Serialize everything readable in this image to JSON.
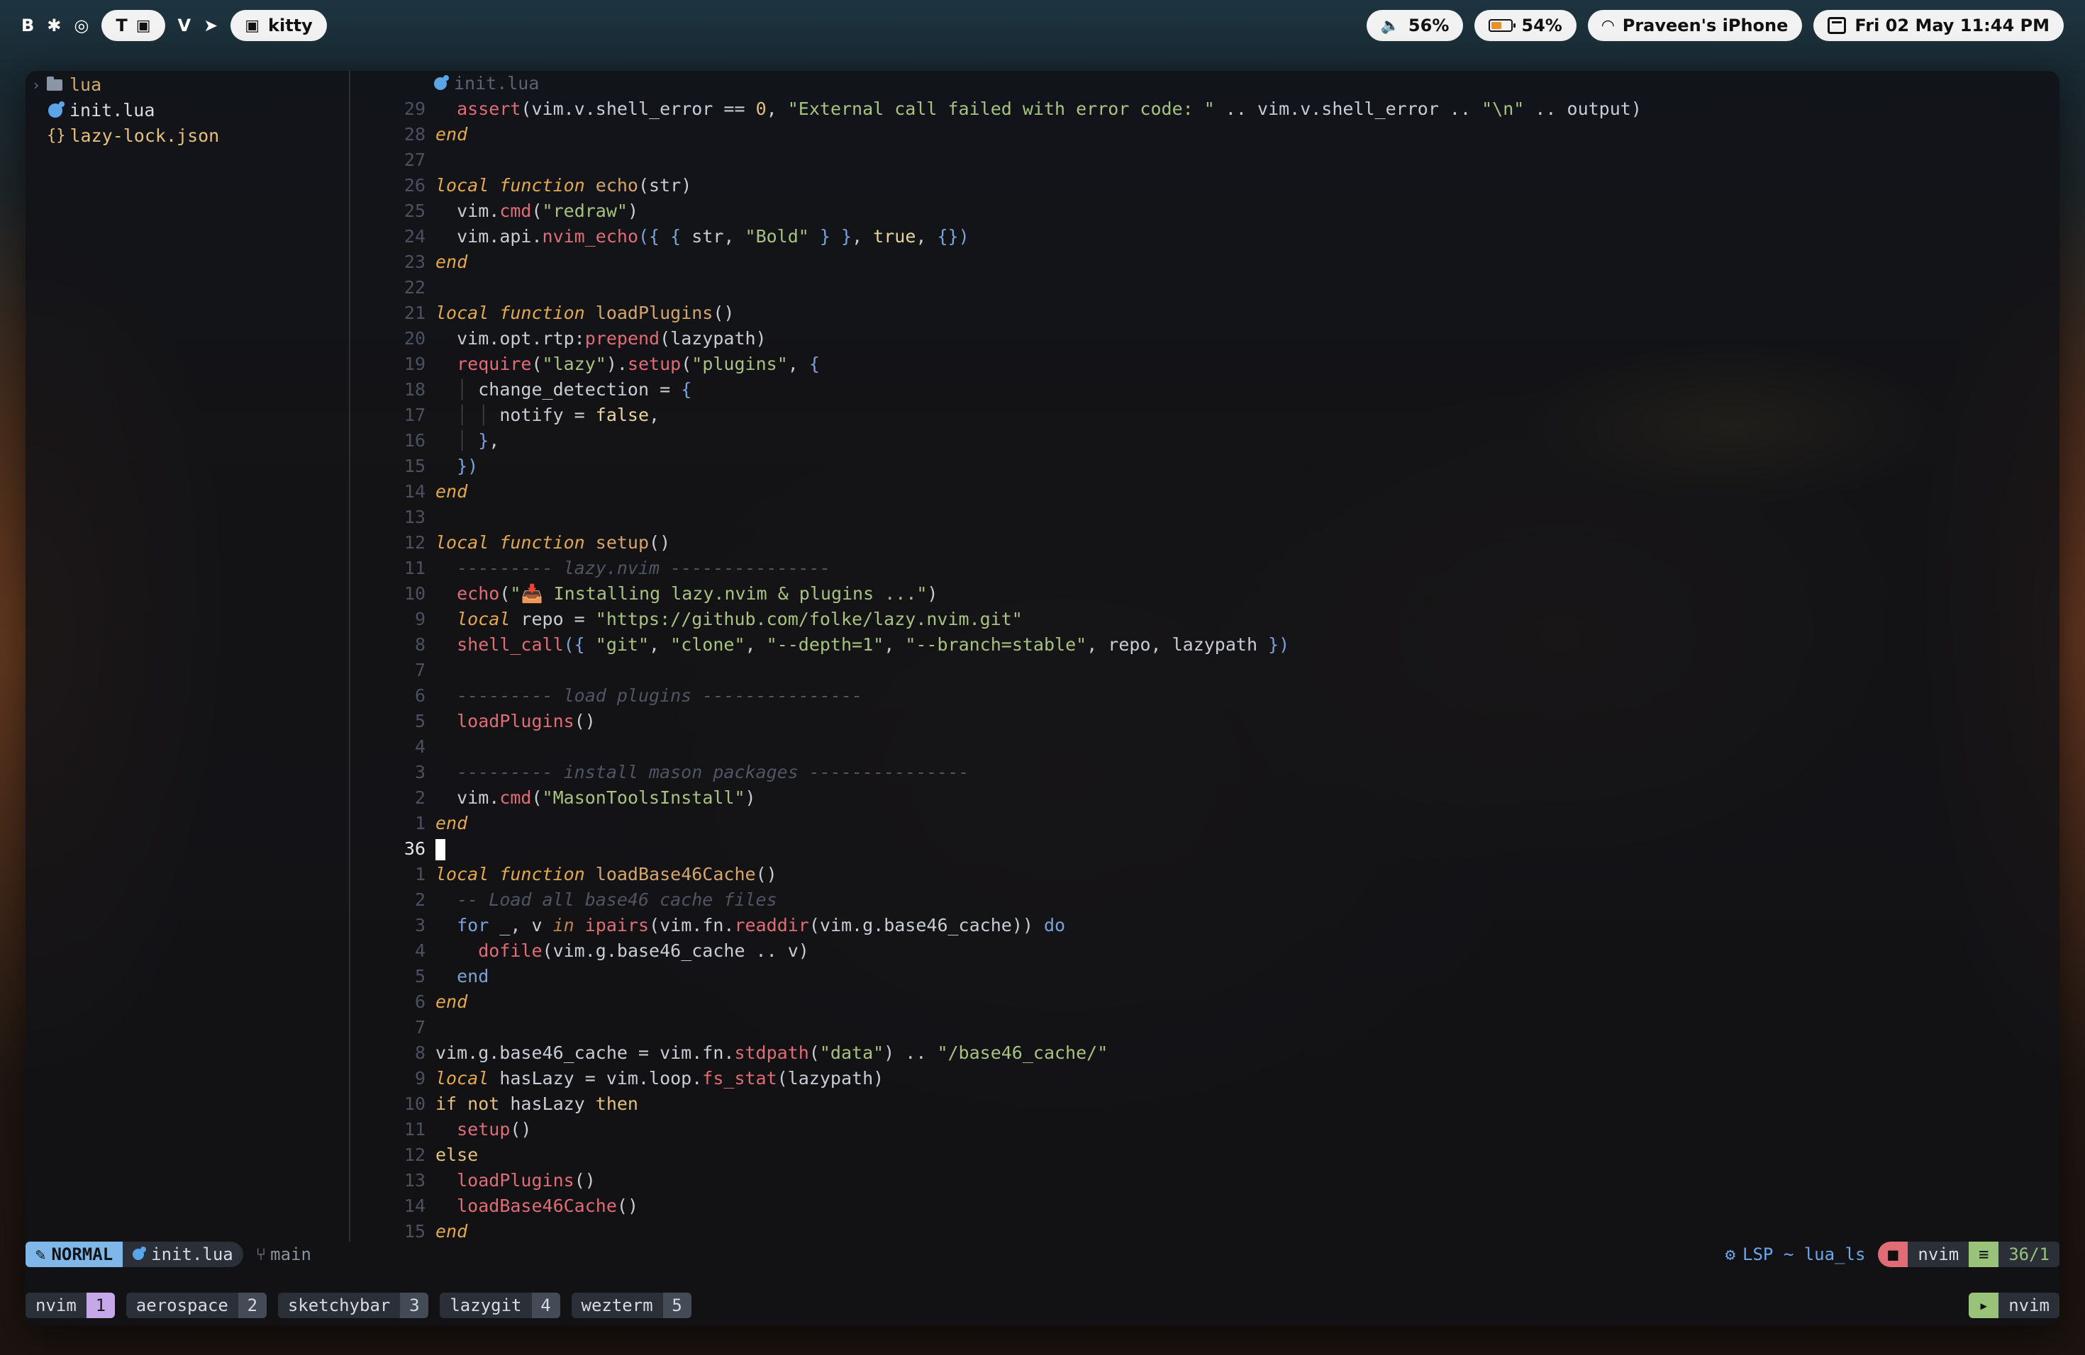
{
  "menubar": {
    "left_glyphs": [
      "B",
      "✱",
      "◎"
    ],
    "workspace_letter": "T",
    "workspace_icon": "terminal-icon",
    "v_label": "V",
    "kitty_label": "kitty",
    "volume": "56%",
    "battery": "54%",
    "wifi_network": "Praveen's iPhone",
    "datetime": "Fri 02 May 11:44 PM"
  },
  "file_tree": {
    "items": [
      {
        "label": "lua",
        "type": "folder"
      },
      {
        "label": "init.lua",
        "type": "lua"
      },
      {
        "label": "lazy-lock.json",
        "type": "json"
      }
    ]
  },
  "editor": {
    "winbar_filename": "init.lua",
    "current_line_number": "36",
    "lines": [
      {
        "n": "29",
        "tokens": [
          [
            "guide",
            "  "
          ],
          [
            "call",
            "assert"
          ],
          [
            "ident",
            "(vim.v.shell_error == "
          ],
          [
            "num",
            "0"
          ],
          [
            "ident",
            ", "
          ],
          [
            "str",
            "\"External call failed with error code: \""
          ],
          [
            "ident",
            " .. vim.v.shell_error .. "
          ],
          [
            "str",
            "\"\\n\""
          ],
          [
            "ident",
            " .. output)"
          ]
        ]
      },
      {
        "n": "28",
        "tokens": [
          [
            "kw",
            "end"
          ]
        ]
      },
      {
        "n": "27",
        "tokens": []
      },
      {
        "n": "26",
        "tokens": [
          [
            "kw",
            "local function "
          ],
          [
            "fn",
            "echo"
          ],
          [
            "ident",
            "(str)"
          ]
        ]
      },
      {
        "n": "25",
        "tokens": [
          [
            "guide",
            "  "
          ],
          [
            "ident",
            "vim."
          ],
          [
            "call",
            "cmd"
          ],
          [
            "ident",
            "("
          ],
          [
            "str",
            "\"redraw\""
          ],
          [
            "ident",
            ")"
          ]
        ]
      },
      {
        "n": "24",
        "tokens": [
          [
            "guide",
            "  "
          ],
          [
            "ident",
            "vim.api."
          ],
          [
            "call",
            "nvim_echo"
          ],
          [
            "br",
            "({ { "
          ],
          [
            "ident",
            "str, "
          ],
          [
            "str",
            "\"Bold\""
          ],
          [
            "br",
            " } }"
          ],
          [
            "ident",
            ", "
          ],
          [
            "bool",
            "true"
          ],
          [
            "ident",
            ", "
          ],
          [
            "br",
            "{})"
          ]
        ]
      },
      {
        "n": "23",
        "tokens": [
          [
            "kw",
            "end"
          ]
        ]
      },
      {
        "n": "22",
        "tokens": []
      },
      {
        "n": "21",
        "tokens": [
          [
            "kw",
            "local function "
          ],
          [
            "fn",
            "loadPlugins"
          ],
          [
            "ident",
            "()"
          ]
        ]
      },
      {
        "n": "20",
        "tokens": [
          [
            "guide",
            "  "
          ],
          [
            "ident",
            "vim.opt.rtp:"
          ],
          [
            "call",
            "prepend"
          ],
          [
            "ident",
            "(lazypath)"
          ]
        ]
      },
      {
        "n": "19",
        "tokens": [
          [
            "guide",
            "  "
          ],
          [
            "call",
            "require"
          ],
          [
            "ident",
            "("
          ],
          [
            "str",
            "\"lazy\""
          ],
          [
            "ident",
            ")."
          ],
          [
            "call",
            "setup"
          ],
          [
            "ident",
            "("
          ],
          [
            "str",
            "\"plugins\""
          ],
          [
            "ident",
            ", "
          ],
          [
            "br",
            "{"
          ]
        ]
      },
      {
        "n": "18",
        "tokens": [
          [
            "guide",
            "  │ "
          ],
          [
            "ident",
            "change_detection = "
          ],
          [
            "br",
            "{"
          ]
        ]
      },
      {
        "n": "17",
        "tokens": [
          [
            "guide",
            "  │ │ "
          ],
          [
            "ident",
            "notify = "
          ],
          [
            "bool",
            "false"
          ],
          [
            "ident",
            ","
          ]
        ]
      },
      {
        "n": "16",
        "tokens": [
          [
            "guide",
            "  │ "
          ],
          [
            "br",
            "}"
          ],
          [
            "ident",
            ","
          ]
        ]
      },
      {
        "n": "15",
        "tokens": [
          [
            "guide",
            "  "
          ],
          [
            "br",
            "})"
          ]
        ]
      },
      {
        "n": "14",
        "tokens": [
          [
            "kw",
            "end"
          ]
        ]
      },
      {
        "n": "13",
        "tokens": []
      },
      {
        "n": "12",
        "tokens": [
          [
            "kw",
            "local function "
          ],
          [
            "fn",
            "setup"
          ],
          [
            "ident",
            "()"
          ]
        ]
      },
      {
        "n": "11",
        "tokens": [
          [
            "guide",
            "  "
          ],
          [
            "cmt",
            "--------- lazy.nvim ---------------"
          ]
        ]
      },
      {
        "n": "10",
        "tokens": [
          [
            "guide",
            "  "
          ],
          [
            "call",
            "echo"
          ],
          [
            "ident",
            "("
          ],
          [
            "str",
            "\"📥 Installing lazy.nvim & plugins ...\""
          ],
          [
            "ident",
            ")"
          ]
        ]
      },
      {
        "n": "9",
        "tokens": [
          [
            "guide",
            "  "
          ],
          [
            "kw",
            "local "
          ],
          [
            "ident",
            "repo = "
          ],
          [
            "str",
            "\"https://github.com/folke/lazy.nvim.git\""
          ]
        ]
      },
      {
        "n": "8",
        "tokens": [
          [
            "guide",
            "  "
          ],
          [
            "call",
            "shell_call"
          ],
          [
            "br",
            "({ "
          ],
          [
            "str",
            "\"git\""
          ],
          [
            "ident",
            ", "
          ],
          [
            "str",
            "\"clone\""
          ],
          [
            "ident",
            ", "
          ],
          [
            "str",
            "\"--depth=1\""
          ],
          [
            "ident",
            ", "
          ],
          [
            "str",
            "\"--branch=stable\""
          ],
          [
            "ident",
            ", repo, lazypath "
          ],
          [
            "br",
            "})"
          ]
        ]
      },
      {
        "n": "7",
        "tokens": []
      },
      {
        "n": "6",
        "tokens": [
          [
            "guide",
            "  "
          ],
          [
            "cmt",
            "--------- load plugins ---------------"
          ]
        ]
      },
      {
        "n": "5",
        "tokens": [
          [
            "guide",
            "  "
          ],
          [
            "call",
            "loadPlugins"
          ],
          [
            "ident",
            "()"
          ]
        ]
      },
      {
        "n": "4",
        "tokens": []
      },
      {
        "n": "3",
        "tokens": [
          [
            "guide",
            "  "
          ],
          [
            "cmt",
            "--------- install mason packages ---------------"
          ]
        ]
      },
      {
        "n": "2",
        "tokens": [
          [
            "guide",
            "  "
          ],
          [
            "ident",
            "vim."
          ],
          [
            "call",
            "cmd"
          ],
          [
            "ident",
            "("
          ],
          [
            "str",
            "\"MasonToolsInstall\""
          ],
          [
            "ident",
            ")"
          ]
        ]
      },
      {
        "n": "1",
        "tokens": [
          [
            "kw",
            "end"
          ]
        ]
      },
      {
        "n": "36",
        "current": true,
        "tokens": []
      },
      {
        "n": "1",
        "tokens": [
          [
            "kw",
            "local function "
          ],
          [
            "fn",
            "loadBase46Cache"
          ],
          [
            "ident",
            "()"
          ]
        ]
      },
      {
        "n": "2",
        "tokens": [
          [
            "guide",
            "  "
          ],
          [
            "cmt",
            "-- Load all base46 cache files"
          ]
        ]
      },
      {
        "n": "3",
        "tokens": [
          [
            "guide",
            "  "
          ],
          [
            "br",
            "for "
          ],
          [
            "ident",
            "_, v "
          ],
          [
            "kw2",
            "in "
          ],
          [
            "call",
            "ipairs"
          ],
          [
            "ident",
            "(vim.fn."
          ],
          [
            "call",
            "readdir"
          ],
          [
            "ident",
            "(vim.g.base46_cache)) "
          ],
          [
            "br",
            "do"
          ]
        ]
      },
      {
        "n": "4",
        "tokens": [
          [
            "guide",
            "    "
          ],
          [
            "call",
            "dofile"
          ],
          [
            "ident",
            "(vim.g.base46_cache .. v)"
          ]
        ]
      },
      {
        "n": "5",
        "tokens": [
          [
            "guide",
            "  "
          ],
          [
            "br",
            "end"
          ]
        ]
      },
      {
        "n": "6",
        "tokens": [
          [
            "kw",
            "end"
          ]
        ]
      },
      {
        "n": "7",
        "tokens": []
      },
      {
        "n": "8",
        "tokens": [
          [
            "ident",
            "vim.g.base46_cache = vim.fn."
          ],
          [
            "call",
            "stdpath"
          ],
          [
            "ident",
            "("
          ],
          [
            "str",
            "\"data\""
          ],
          [
            "ident",
            ") .. "
          ],
          [
            "str",
            "\"/base46_cache/\""
          ]
        ]
      },
      {
        "n": "9",
        "tokens": [
          [
            "kw",
            "local "
          ],
          [
            "ident",
            "hasLazy = vim.loop."
          ],
          [
            "call",
            "fs_stat"
          ],
          [
            "ident",
            "(lazypath)"
          ]
        ]
      },
      {
        "n": "10",
        "tokens": [
          [
            "num",
            "if not "
          ],
          [
            "ident",
            "hasLazy "
          ],
          [
            "num",
            "then"
          ]
        ]
      },
      {
        "n": "11",
        "tokens": [
          [
            "guide",
            "  "
          ],
          [
            "call",
            "setup"
          ],
          [
            "ident",
            "()"
          ]
        ]
      },
      {
        "n": "12",
        "tokens": [
          [
            "num",
            "else"
          ]
        ]
      },
      {
        "n": "13",
        "tokens": [
          [
            "guide",
            "  "
          ],
          [
            "call",
            "loadPlugins"
          ],
          [
            "ident",
            "()"
          ]
        ]
      },
      {
        "n": "14",
        "tokens": [
          [
            "guide",
            "  "
          ],
          [
            "call",
            "loadBase46Cache"
          ],
          [
            "ident",
            "()"
          ]
        ]
      },
      {
        "n": "15",
        "tokens": [
          [
            "kw",
            "end"
          ]
        ]
      }
    ]
  },
  "statusline": {
    "mode": "NORMAL",
    "file": "init.lua",
    "branch": "main",
    "lsp": "LSP ~ lua_ls",
    "dir": "nvim",
    "position": "36/1"
  },
  "tabline": {
    "tabs": [
      {
        "name": "nvim",
        "num": "1",
        "active": true
      },
      {
        "name": "aerospace",
        "num": "2",
        "active": false
      },
      {
        "name": "sketchybar",
        "num": "3",
        "active": false
      },
      {
        "name": "lazygit",
        "num": "4",
        "active": false
      },
      {
        "name": "wezterm",
        "num": "5",
        "active": false
      }
    ],
    "right_label": "nvim"
  },
  "colors": {
    "mode_bg": "#7fb8e8",
    "active_tab": "#c6a8e8",
    "accent_green": "#98c379",
    "accent_red": "#e06c75"
  }
}
